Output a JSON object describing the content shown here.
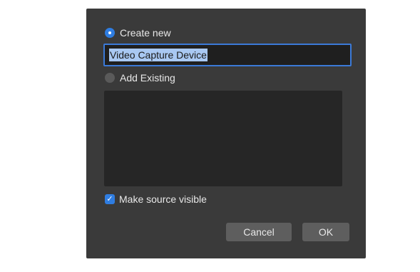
{
  "dialog": {
    "create_new_label": "Create new",
    "create_new_selected": true,
    "name_value": "Video Capture Device",
    "add_existing_label": "Add Existing",
    "add_existing_selected": false,
    "make_visible_label": "Make source visible",
    "make_visible_checked": true,
    "cancel_label": "Cancel",
    "ok_label": "OK"
  },
  "colors": {
    "dialog_bg": "#3a3a3a",
    "accent": "#2f7de1",
    "field_bg": "#1f1f1f",
    "list_bg": "#262626",
    "button_bg": "#5e5e5e",
    "text": "#e8e8e8"
  },
  "icons": {
    "check": "checkmark-icon"
  }
}
